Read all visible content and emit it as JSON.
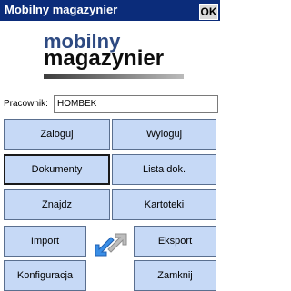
{
  "window": {
    "title": "Mobilny magazynier",
    "ok_label": "OK"
  },
  "logo": {
    "line1": "mobilny",
    "line2": "magazynier"
  },
  "employee": {
    "label": "Pracownik:",
    "value": "HOMBEK"
  },
  "buttons": {
    "login": "Zaloguj",
    "logout": "Wyloguj",
    "documents": "Dokumenty",
    "document_list": "Lista dok.",
    "find": "Znajdz",
    "cards": "Kartoteki",
    "import": "Import",
    "export": "Eksport",
    "configuration": "Konfiguracja",
    "close": "Zamknij"
  },
  "icons": {
    "sync": "import-export-arrows-icon"
  },
  "colors": {
    "titlebar": "#0b2c7a",
    "button_fill": "#c6d9f6",
    "logo_blue": "#2e4a82",
    "arrow_blue": "#3a8ee6"
  }
}
